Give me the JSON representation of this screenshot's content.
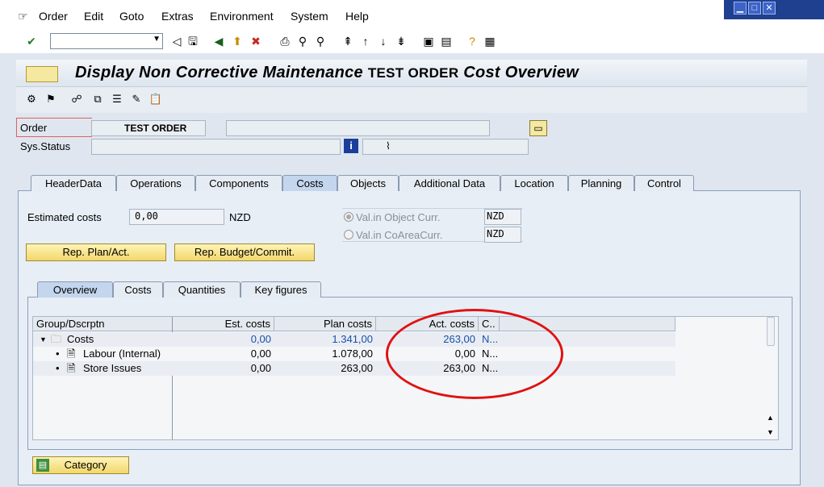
{
  "menu": {
    "items": [
      "Order",
      "Edit",
      "Goto",
      "Extras",
      "Environment",
      "System",
      "Help"
    ]
  },
  "title": {
    "prefix": "Display Non Corrective Maintenance",
    "order": "TEST ORDER",
    "suffix": "Cost Overview"
  },
  "header": {
    "order_label": "Order",
    "order_value": "TEST ORDER",
    "sysstatus_label": "Sys.Status",
    "sysstatus_value": "⌇"
  },
  "tabs": [
    "HeaderData",
    "Operations",
    "Components",
    "Costs",
    "Objects",
    "Additional Data",
    "Location",
    "Planning",
    "Control"
  ],
  "costs_tab": {
    "estimated_costs_label": "Estimated costs",
    "estimated_costs_value": "0,00",
    "currency": "NZD",
    "radio_object_curr_label": "Val.in Object Curr.",
    "radio_object_curr_value": "NZD",
    "radio_coarea_curr_label": "Val.in CoAreaCurr.",
    "radio_coarea_curr_value": "NZD",
    "btn_rep_plan": "Rep. Plan/Act.",
    "btn_rep_budget": "Rep. Budget/Commit."
  },
  "subtabs": [
    "Overview",
    "Costs",
    "Quantities",
    "Key figures"
  ],
  "grid": {
    "headers": [
      "Group/Dscrptn",
      "Est. costs",
      "Plan costs",
      "Act. costs",
      "C.."
    ],
    "rows": [
      {
        "name": "Costs",
        "est": "0,00",
        "plan": "1.341,00",
        "act": "263,00",
        "cur": "N..."
      },
      {
        "name": "Labour (Internal)",
        "est": "0,00",
        "plan": "1.078,00",
        "act": "0,00",
        "cur": "N..."
      },
      {
        "name": "Store Issues",
        "est": "0,00",
        "plan": "263,00",
        "act": "263,00",
        "cur": "N..."
      }
    ]
  },
  "footer": {
    "category_button": "Category"
  },
  "colors": {
    "accent_blue": "#1a4fa8",
    "annotation_red": "#e01212",
    "button_yellow": "#f2d76a"
  }
}
